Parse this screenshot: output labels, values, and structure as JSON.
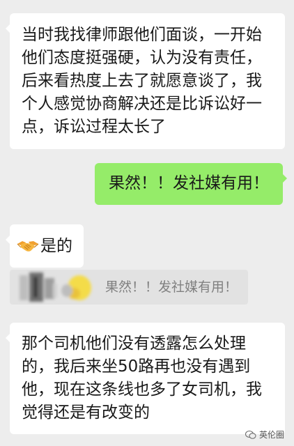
{
  "messages": [
    {
      "side": "left",
      "text": "当时我找律师跟他们面谈，一开始他们态度挺强硬，认为没有责任，后来看热度上去了就愿意谈了，我个人感觉协商解决还是比诉讼好一点，诉讼过程太长了"
    },
    {
      "side": "right",
      "text": "果然！！发社媒有用！"
    },
    {
      "side": "left",
      "emoji": "handshake-icon",
      "text": "是的"
    },
    {
      "side": "left",
      "text": "那个司机他们没有透露怎么处理的，我后来坐50路再也没有遇到他，现在这条线也多了女司机，我觉得还是有改变的"
    }
  ],
  "quote": {
    "text": "果然！！发社媒有用！"
  },
  "watermark": {
    "text": "英伦圈"
  },
  "colors": {
    "background": "#ededed",
    "incoming_bubble": "#ffffff",
    "outgoing_bubble": "#95ec69",
    "quote_background": "#e2e2e2",
    "quote_text": "#808080"
  }
}
